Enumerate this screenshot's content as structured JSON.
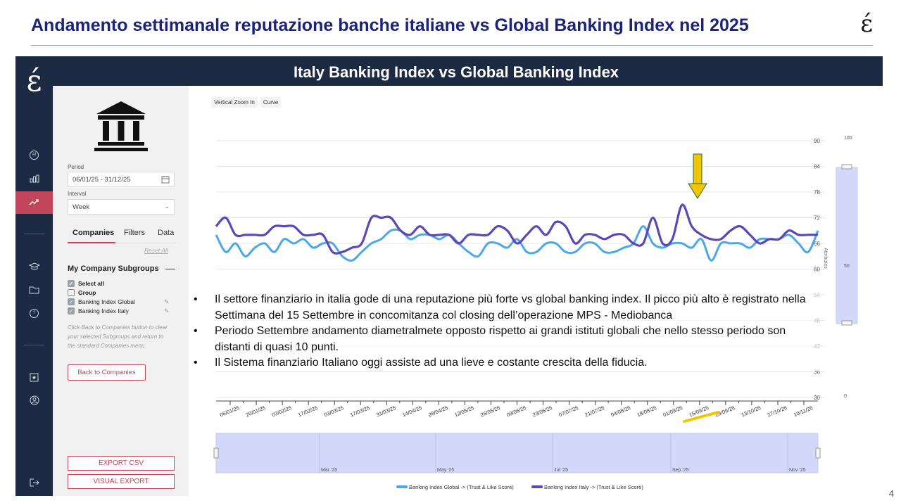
{
  "slide": {
    "title": "Andamento settimanale reputazione banche italiane vs Global Banking Index nel 2025",
    "brand": "έ",
    "page_number": "4"
  },
  "app": {
    "banner_title": "Italy Banking Index vs Global Banking Index",
    "logo": "έ",
    "nav": [
      "ai-icon",
      "bar-chart-icon",
      "trend-icon",
      "graduation-cap-icon",
      "folder-icon",
      "help-icon",
      "bookmark-star-icon",
      "user-icon",
      "logout-icon"
    ],
    "accent": "#c1455b",
    "nav_bg": "#1d2a44"
  },
  "filters": {
    "period_label": "Period",
    "period_value": "06/01/25 - 31/12/25",
    "interval_label": "Interval",
    "interval_value": "Week",
    "tabs": [
      "Companies",
      "Filters",
      "Data"
    ],
    "reset": "Reset All",
    "subgroups_title": "My Company Subgroups",
    "checks": [
      {
        "label": "Select all",
        "checked": true
      },
      {
        "label": "Group",
        "checked": false
      },
      {
        "label": "Banking Index Global",
        "checked": true
      },
      {
        "label": "Banking Index Italy",
        "checked": true
      }
    ],
    "hint": "Click Back to Companies button to clear your selected Subgroups and return to the standard Companies menu.",
    "back_button": "Back to Companies",
    "export_csv": "EXPORT CSV",
    "visual_export": "VISUAL EXPORT"
  },
  "toolbar": {
    "zoom": "Vertical Zoom In",
    "curve": "Curve"
  },
  "chart_data": {
    "type": "line",
    "y_ticks": [
      "90",
      "84",
      "78",
      "72",
      "66",
      "60",
      "54",
      "48",
      "42",
      "36",
      "30"
    ],
    "ylim": [
      30,
      90
    ],
    "ylabel": "Attributes",
    "slider_ticks": [
      "100",
      "50",
      "0"
    ],
    "x_tick_labels": [
      "06/01/25",
      "20/01/25",
      "03/02/25",
      "17/02/25",
      "03/03/25",
      "17/03/25",
      "31/03/25",
      "14/04/25",
      "28/04/25",
      "12/05/25",
      "26/05/25",
      "09/06/25",
      "23/06/25",
      "07/07/25",
      "21/07/25",
      "04/08/25",
      "18/08/25",
      "01/09/25",
      "15/09/25",
      "29/09/25",
      "13/10/25",
      "27/10/25",
      "10/11/25"
    ],
    "navigator_labels": [
      "Mar '25",
      "May '25",
      "Jul '25",
      "Sep '25",
      "Nov '25"
    ],
    "series": [
      {
        "name": "Banking Index Global -> (Trust & Like Score)",
        "color": "#4aa8e8",
        "values": [
          68,
          64,
          66,
          63,
          65,
          66,
          64,
          67,
          66,
          67,
          65,
          66,
          66,
          63,
          62,
          64,
          66,
          67,
          69,
          69,
          67,
          68,
          68,
          67,
          68,
          66,
          64,
          63,
          66,
          66,
          65,
          67,
          64,
          64,
          66,
          66,
          64,
          64,
          66,
          66,
          64,
          64,
          65,
          66,
          70,
          66,
          65,
          66,
          66,
          65,
          67,
          62,
          66,
          66,
          66,
          65,
          67,
          67,
          67,
          68,
          66,
          64,
          69
        ]
      },
      {
        "name": "Banking Index Italy -> (Trust & Like Score)",
        "color": "#5a47b8",
        "values": [
          70,
          72,
          68,
          68,
          68,
          68,
          70,
          70,
          70,
          68,
          68,
          68,
          64,
          64,
          65,
          66,
          72,
          72,
          72,
          69,
          68,
          70,
          68,
          68,
          68,
          66,
          68,
          68,
          68,
          70,
          69,
          66,
          68,
          70,
          68,
          71,
          70,
          66,
          68,
          68,
          67,
          68,
          68,
          66,
          66,
          72,
          66,
          67,
          75,
          70,
          68,
          67,
          67,
          69,
          70,
          68,
          66,
          67,
          67,
          69,
          68,
          68,
          68
        ]
      }
    ]
  },
  "bullets": [
    "Il settore finanziario in italia gode di una reputazione più forte vs global banking index. Il picco più alto è registrato nella Settimana del 15 Settembre in concomitanza col closing dell’operazione MPS - Mediobanca",
    "Periodo Settembre andamento diametralmete opposto rispetto ai grandi istituti globali che nello stesso periodo son distanti di quasi 10 punti.",
    "Il Sistema finanziario Italiano oggi assiste ad una lieve e costante crescita della fiducia."
  ],
  "annotations": {
    "arrow_color": "#f2c500",
    "highlight_color": "#f2c500"
  }
}
